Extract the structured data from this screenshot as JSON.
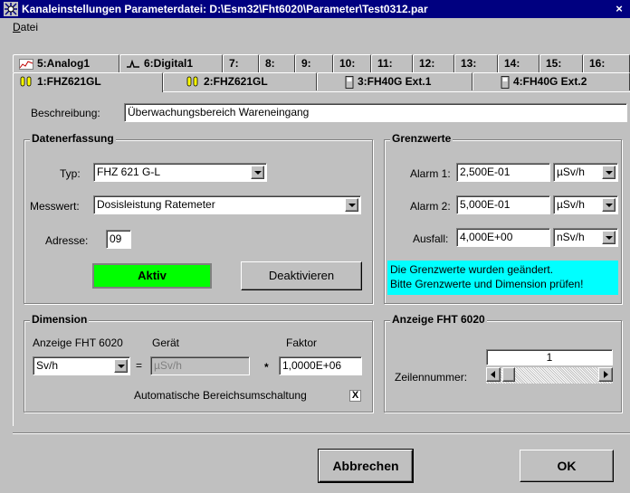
{
  "window": {
    "title": "Kanaleinstellungen   Parameterdatei: D:\\Esm32\\Fht6020\\Parameter\\Test0312.par",
    "close_glyph": "×",
    "icon": "sensor-app-icon"
  },
  "menu": {
    "items": [
      {
        "label": "Datei"
      }
    ]
  },
  "tabs_top": [
    {
      "label": "5:Analog1",
      "icon": "analog-chart-icon"
    },
    {
      "label": "6:Digital1",
      "icon": "digital-signal-icon"
    },
    {
      "label": "7:"
    },
    {
      "label": "8:"
    },
    {
      "label": "9:"
    },
    {
      "label": "10:"
    },
    {
      "label": "11:"
    },
    {
      "label": "12:"
    },
    {
      "label": "13:"
    },
    {
      "label": "14:"
    },
    {
      "label": "15:"
    },
    {
      "label": "16:"
    }
  ],
  "tabs_bottom": [
    {
      "label": "1:FHZ621GL",
      "icon": "dual-probe-icon",
      "active": true
    },
    {
      "label": "2:FHZ621GL",
      "icon": "dual-probe-icon",
      "active": false
    },
    {
      "label": "3:FH40G Ext.1",
      "icon": "handheld-meter-icon",
      "active": false
    },
    {
      "label": "4:FH40G Ext.2",
      "icon": "handheld-meter-icon",
      "active": false
    }
  ],
  "beschreibung": {
    "label": "Beschreibung:",
    "value": "Überwachungsbereich Wareneingang"
  },
  "datenerfassung": {
    "title": "Datenerfassung",
    "typ_label": "Typ:",
    "typ_value": "FHZ 621 G-L",
    "messwert_label": "Messwert:",
    "messwert_value": "Dosisleistung Ratemeter",
    "adresse_label": "Adresse:",
    "adresse_value": "09",
    "status_label": "Aktiv",
    "status_color": "#00ff00",
    "deactivate_label": "Deaktivieren"
  },
  "grenzwerte": {
    "title": "Grenzwerte",
    "rows": [
      {
        "label": "Alarm 1:",
        "value": "2,500E-01",
        "unit": "µSv/h"
      },
      {
        "label": "Alarm 2:",
        "value": "5,000E-01",
        "unit": "µSv/h"
      },
      {
        "label": "Ausfall:",
        "value": "4,000E+00",
        "unit": "nSv/h"
      }
    ],
    "notice_line1": "Die Grenzwerte wurden geändert.",
    "notice_line2": "Bitte Grenzwerte und Dimension prüfen!",
    "notice_color": "#00ffff"
  },
  "dimension": {
    "title": "Dimension",
    "anzeige_label": "Anzeige FHT 6020",
    "anzeige_value": "Sv/h",
    "geraet_label": "Gerät",
    "geraet_value": "µSv/h",
    "equals": "=",
    "times": "*",
    "faktor_label": "Faktor",
    "faktor_value": "1,0000E+06",
    "auto_label": "Automatische Bereichsumschaltung",
    "auto_checked": true,
    "check_glyph": "X"
  },
  "anzeige": {
    "title": "Anzeige FHT 6020",
    "zeilen_label": "Zeilennummer:",
    "zeilen_value": "1"
  },
  "footer": {
    "cancel_label": "Abbrechen",
    "ok_label": "OK"
  }
}
